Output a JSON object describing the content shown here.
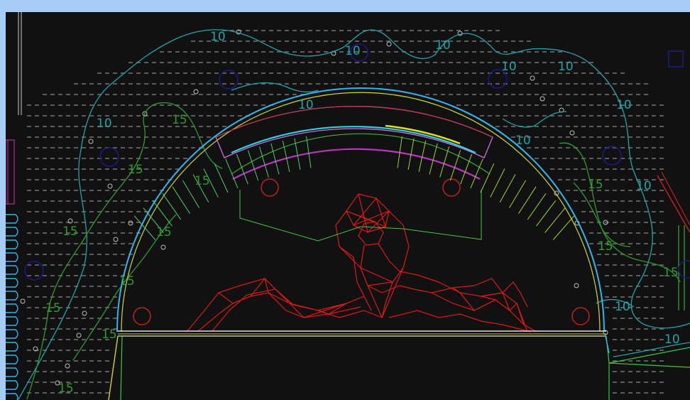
{
  "drawing": {
    "colors": {
      "background": "#111111",
      "frame": "#a7cdf6",
      "contour_cyan": "#1fa5a8",
      "contour_green": "#2f9a2f",
      "audience_red": "#e01818",
      "grid_points": "#9a9a9a",
      "arc_blue": "#2fb6f0",
      "arc_yellow": "#c8c826",
      "arc_magenta": "#c032c8",
      "outline_green": "#3fc73f",
      "stage_white": "#e0e0e0",
      "symbol_navy": "#1a1a8a",
      "truss_red": "#c02020",
      "screen_edge": "#d070e0"
    },
    "contour_labels": [
      {
        "text": "10",
        "series": "cyan"
      },
      {
        "text": "10",
        "series": "cyan"
      },
      {
        "text": "10",
        "series": "cyan"
      },
      {
        "text": "10",
        "series": "cyan"
      },
      {
        "text": "10",
        "series": "cyan"
      },
      {
        "text": "10",
        "series": "cyan"
      },
      {
        "text": "10",
        "series": "cyan"
      },
      {
        "text": "10",
        "series": "cyan"
      },
      {
        "text": "10",
        "series": "cyan"
      },
      {
        "text": "10",
        "series": "cyan"
      },
      {
        "text": "10",
        "series": "cyan"
      },
      {
        "text": "10",
        "series": "cyan"
      },
      {
        "text": "15",
        "series": "green"
      },
      {
        "text": "15",
        "series": "green"
      },
      {
        "text": "15",
        "series": "green"
      },
      {
        "text": "15",
        "series": "green"
      },
      {
        "text": "15",
        "series": "green"
      },
      {
        "text": "15",
        "series": "green"
      },
      {
        "text": "15",
        "series": "green"
      },
      {
        "text": "15",
        "series": "green"
      },
      {
        "text": "15",
        "series": "green"
      },
      {
        "text": "15",
        "series": "green"
      },
      {
        "text": "15",
        "series": "green"
      },
      {
        "text": "15",
        "series": "green"
      }
    ]
  }
}
